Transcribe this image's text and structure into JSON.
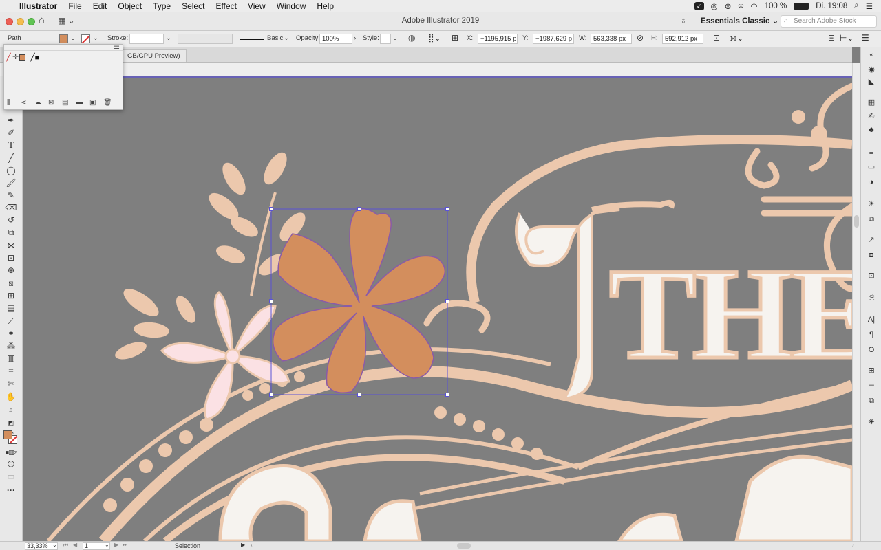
{
  "menubar": {
    "app": "Illustrator",
    "items": [
      "File",
      "Edit",
      "Object",
      "Type",
      "Select",
      "Effect",
      "View",
      "Window",
      "Help"
    ],
    "battery": "100 %",
    "clock": "Di. 19:08"
  },
  "titlebar": {
    "title": "Adobe Illustrator 2019",
    "workspace": "Essentials Classic",
    "search_placeholder": "Search Adobe Stock"
  },
  "control": {
    "selection_type": "Path",
    "stroke_label": "Stroke:",
    "stroke_profile": "Basic",
    "opacity_label": "Opacity:",
    "opacity_value": "100%",
    "style_label": "Style:",
    "x_label": "X:",
    "x_value": "−1195,915 p",
    "y_label": "Y:",
    "y_value": "−1987,629 p",
    "w_label": "W:",
    "w_value": "563,338 px",
    "h_label": "H:",
    "h_value": "592,912 px"
  },
  "document": {
    "tab_label": "GB/GPU Preview)"
  },
  "artwork": {
    "headline": "THE"
  },
  "status": {
    "zoom": "33,33%",
    "artboard": "1",
    "tool_name": "Selection"
  },
  "colors": {
    "fill": "#d38e5d",
    "art": "#ecc8ad",
    "light": "#f6f3ef",
    "pink": "#fbe1e4",
    "canvas": "#7f7f7f",
    "selection": "#5a52d6"
  }
}
